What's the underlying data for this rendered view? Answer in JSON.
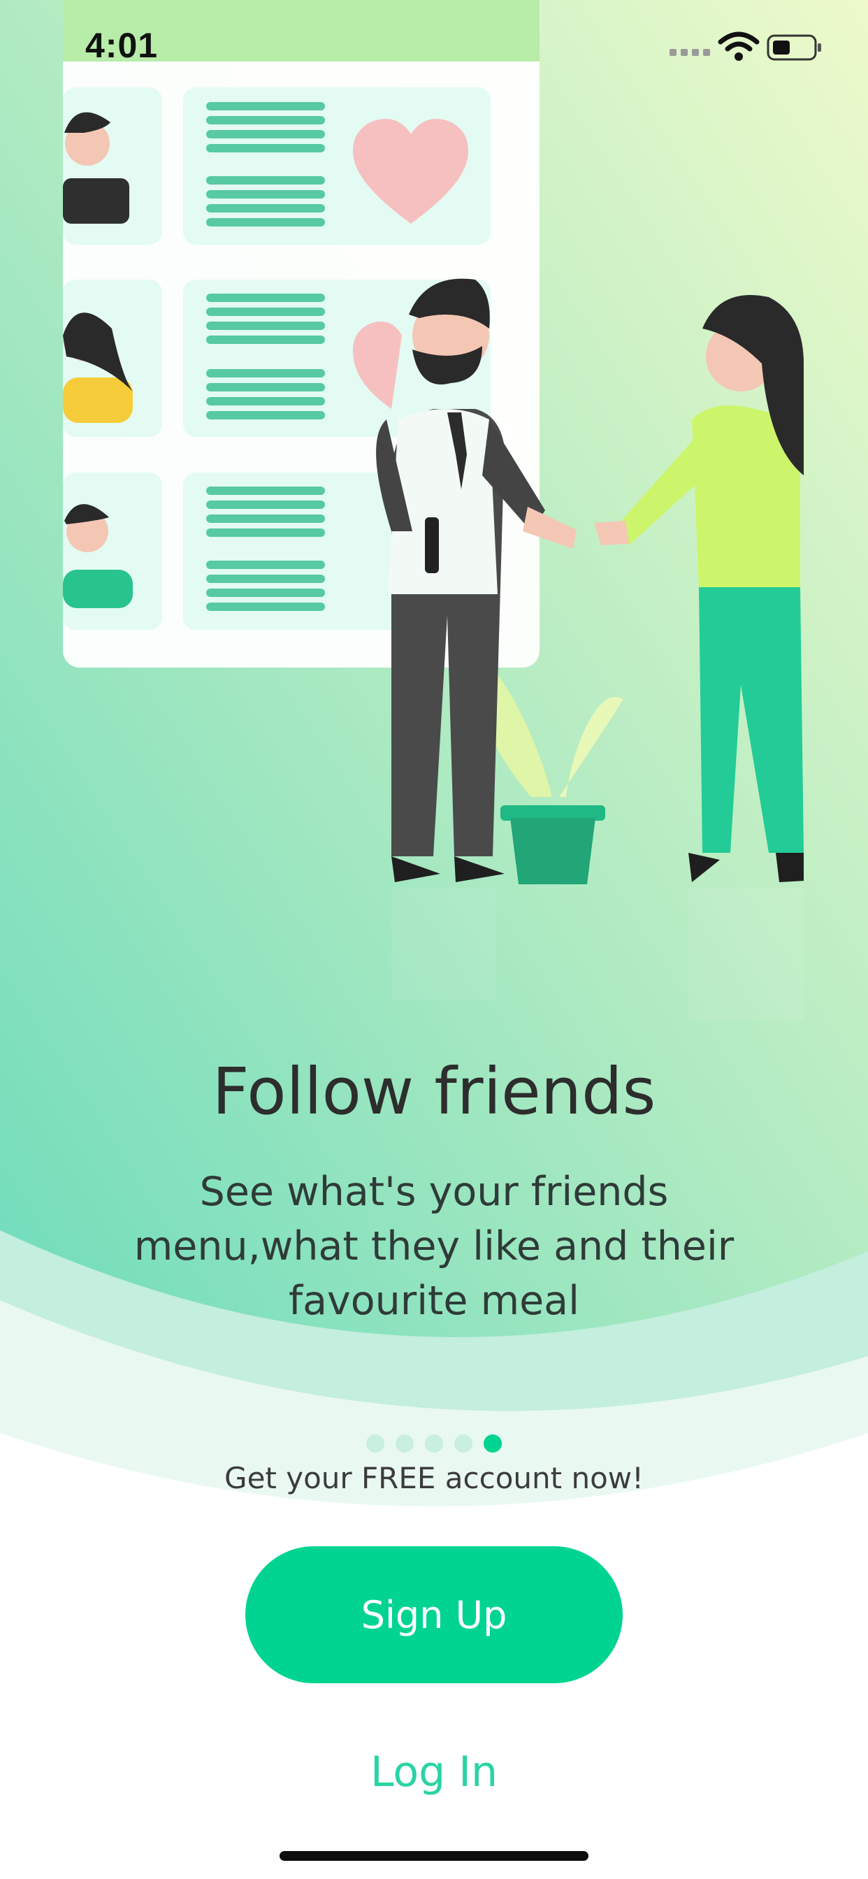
{
  "status_bar": {
    "time": "4:01",
    "icons": [
      "signal-icon",
      "wifi-icon",
      "battery-icon"
    ]
  },
  "onboarding": {
    "illustration": "friends-handshake-illustration",
    "title": "Follow friends",
    "description": "See what's your friends menu,what they like and their favourite meal",
    "page_count": 5,
    "active_page": 5
  },
  "actions": {
    "free_account_text": "Get your FREE account now!",
    "signup_label": "Sign Up",
    "login_label": "Log In"
  },
  "colors": {
    "accent": "#00d490",
    "login_text": "#2ad3a4",
    "hero_top": "#e9f9c7",
    "hero_bottom": "#6fdcb9"
  }
}
